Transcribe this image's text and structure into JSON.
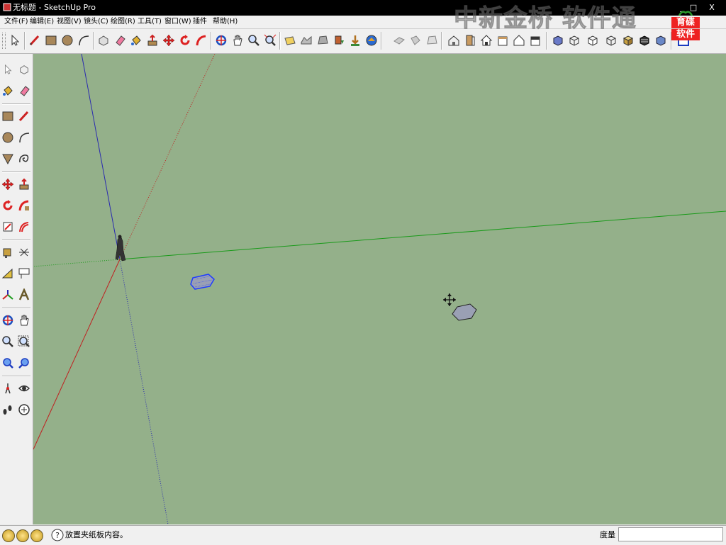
{
  "window": {
    "title": "无标题 - SketchUp Pro",
    "minimize": "_",
    "maximize": "□",
    "close": "X"
  },
  "menu": [
    {
      "label": "文件(F)"
    },
    {
      "label": "编辑(E)"
    },
    {
      "label": "视图(V)"
    },
    {
      "label": "镜头(C)"
    },
    {
      "label": "绘图(R)"
    },
    {
      "label": "工具(T)"
    },
    {
      "label": "窗口(W)"
    },
    {
      "label": "插件"
    },
    {
      "label": "帮助(H)"
    }
  ],
  "watermark": "中新金桥 软件通",
  "logo": {
    "line1": "育碟",
    "line2": "软件"
  },
  "status": {
    "hint": "放置夹纸板内容。",
    "measure_label": "度量",
    "measure_value": ""
  },
  "colors": {
    "viewport_bg": "#94b08a",
    "axis_red": "#c02020",
    "axis_green": "#1a9a1a",
    "axis_blue": "#2a2ab0",
    "selection_blue": "#1f3cff",
    "shape_fill": "#9aa0b4"
  },
  "toolbar_icons": [
    "select-icon",
    "pencil-icon",
    "rectangle-icon",
    "circle-icon",
    "arc-icon",
    "make-component-icon",
    "eraser-icon",
    "paint-bucket-icon",
    "push-pull-icon",
    "move-icon",
    "rotate-icon",
    "follow-me-icon",
    "orbit-icon",
    "pan-icon",
    "zoom-icon",
    "zoom-extents-icon",
    "previous-view-icon",
    "next-view-icon",
    "add-location-icon",
    "toggle-terrain-icon",
    "photo-textures-icon",
    "get-models-icon",
    "share-model-icon",
    "share-component-icon",
    "iso-view-icon",
    "top-view-icon",
    "front-view-icon",
    "right-view-icon",
    "back-view-icon",
    "left-view-icon",
    "xray-icon",
    "wireframe-icon",
    "hidden-line-icon",
    "shaded-icon",
    "shaded-textures-icon",
    "monochrome-icon",
    "component-browser-icon"
  ],
  "left_toolbar_icons": [
    "select-icon",
    "make-component-icon",
    "paint-bucket-icon",
    "eraser-icon",
    "rectangle-icon",
    "line-icon",
    "circle-icon",
    "arc-icon",
    "polygon-icon",
    "freehand-icon",
    "move-icon",
    "push-pull-icon",
    "rotate-icon",
    "follow-me-icon",
    "scale-icon",
    "offset-icon",
    "tape-measure-icon",
    "dimension-icon",
    "protractor-icon",
    "text-icon",
    "axes-icon",
    "3d-text-icon",
    "orbit-icon",
    "pan-icon",
    "zoom-icon",
    "zoom-window-icon",
    "zoom-extents-icon",
    "previous-icon",
    "position-camera-icon",
    "look-around-icon",
    "walk-icon",
    "section-plane-icon"
  ]
}
